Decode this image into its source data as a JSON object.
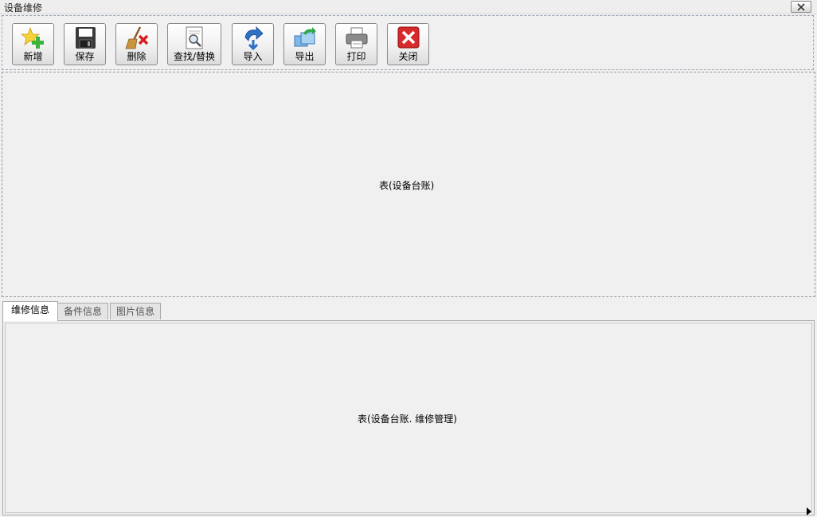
{
  "window": {
    "title": "设备维修"
  },
  "toolbar": {
    "buttons": [
      {
        "label": "新增",
        "icon": "add-star-icon"
      },
      {
        "label": "保存",
        "icon": "floppy-disk-icon"
      },
      {
        "label": "删除",
        "icon": "broom-delete-icon"
      },
      {
        "label": "查找/替换",
        "icon": "find-replace-icon"
      },
      {
        "label": "导入",
        "icon": "import-arrow-icon"
      },
      {
        "label": "导出",
        "icon": "export-icon"
      },
      {
        "label": "打印",
        "icon": "printer-icon"
      },
      {
        "label": "关闭",
        "icon": "close-red-icon"
      }
    ]
  },
  "main_table": {
    "placeholder": "表(设备台账)"
  },
  "tabs": [
    {
      "label": "维修信息",
      "active": true
    },
    {
      "label": "备件信息",
      "active": false
    },
    {
      "label": "图片信息",
      "active": false
    }
  ],
  "detail_table": {
    "placeholder": "表(设备台账. 维修管理)"
  }
}
